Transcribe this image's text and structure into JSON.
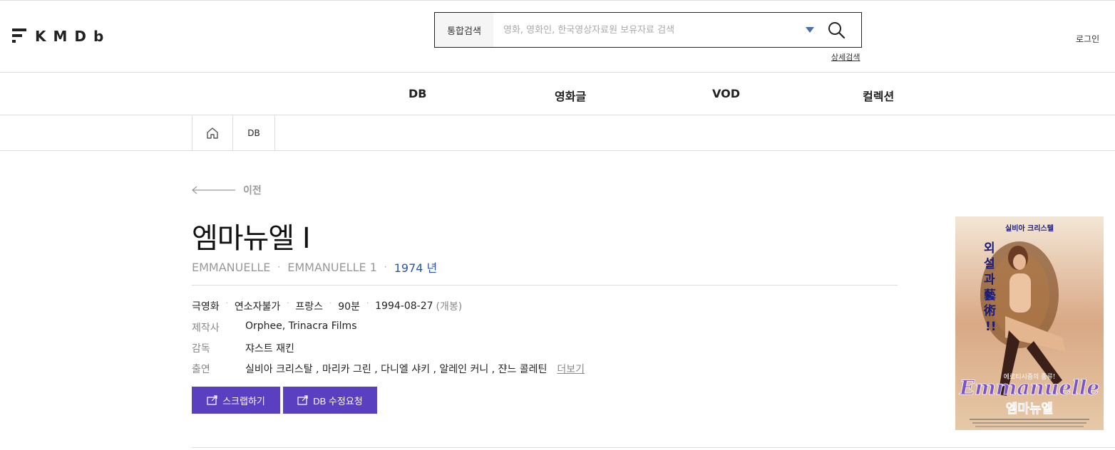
{
  "header": {
    "logo_text": "KMDb",
    "search_type": "통합검색",
    "search_placeholder": "영화, 영화인, 한국영상자료원 보유자료 검색",
    "advanced_search": "상세검색",
    "login": "로그인"
  },
  "nav": {
    "items": [
      "DB",
      "영화글",
      "VOD",
      "컬렉션"
    ]
  },
  "breadcrumb": {
    "current": "DB"
  },
  "back_label": "이전",
  "movie": {
    "title": "엠마뉴엘 I",
    "original_title": "EMMANUELLE",
    "alt_title": "EMMANUELLE 1",
    "year": "1974 년",
    "meta": {
      "genre": "극영화",
      "rating": "연소자불가",
      "country": "프랑스",
      "runtime": "90분",
      "release_date": "1994-08-27",
      "release_note": "(개봉)"
    },
    "production_label": "제작사",
    "production": "Orphee, Trinacra Films",
    "director_label": "감독",
    "director": "쟈스트 재킨",
    "cast_label": "출연",
    "cast": "실비아 크리스탈 , 마리카 그린 , 다니엘 샤키 , 알레인 커니 , 쟌느 콜레틴",
    "more": "더보기"
  },
  "buttons": {
    "scrap": "스크랩하기",
    "edit_request": "DB 수정요청"
  },
  "poster": {
    "top_text": "실비아 크리스텔",
    "headline": "외설과 藝術!!",
    "logo": "Emmanuelle",
    "korean_title": "엠마뉴엘",
    "badge": "에로티시즘의 종류!"
  },
  "colors": {
    "accent": "#5a3fc0",
    "year_blue": "#2a55a5",
    "dropdown_blue": "#4a6fa8"
  }
}
